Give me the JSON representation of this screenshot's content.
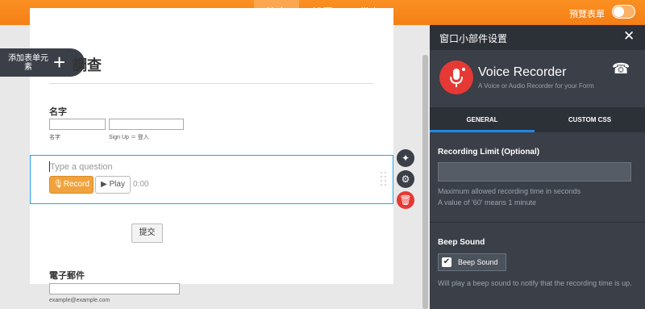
{
  "topbar": {
    "tabs": [
      {
        "label": "建立",
        "active": true
      },
      {
        "label": "設置",
        "active": false
      },
      {
        "label": "发布",
        "active": false
      }
    ],
    "preview_label": "預覽表單"
  },
  "sidebar_button": {
    "label": "添加表单元素"
  },
  "form": {
    "title": "調查",
    "name_field": {
      "label": "名字",
      "sub_first": "名字",
      "sub_last": "Sign Up ＝ 登入"
    },
    "question": {
      "placeholder": "Type a question",
      "record_label": "Record",
      "play_label": "Play",
      "timer": "0:00"
    },
    "submit_label": "提交",
    "email_field": {
      "label": "電子郵件",
      "sub": "example@example.com"
    }
  },
  "panel": {
    "title": "窗口小部件设置",
    "widget_name": "Voice Recorder",
    "widget_desc": "A Voice or Audio Recorder for your Form",
    "tabs": [
      {
        "label": "GENERAL",
        "active": true
      },
      {
        "label": "CUSTOM CSS",
        "active": false
      }
    ],
    "recording_limit": {
      "title": "Recording Limit (Optional)",
      "value": "",
      "hint1": "Maximum allowed recording time in seconds",
      "hint2": "A value of '60' means 1 minute"
    },
    "beep": {
      "title": "Beep Sound",
      "checkbox_label": "Beep Sound",
      "checked": true,
      "hint": "Will play a beep sound to notify that the recording time is up."
    }
  },
  "colors": {
    "topbar": "#f47f16",
    "accent_blue": "#25a7e7",
    "record": "#f0a33c",
    "delete": "#e53935",
    "panel_bg": "#3a3f48"
  }
}
